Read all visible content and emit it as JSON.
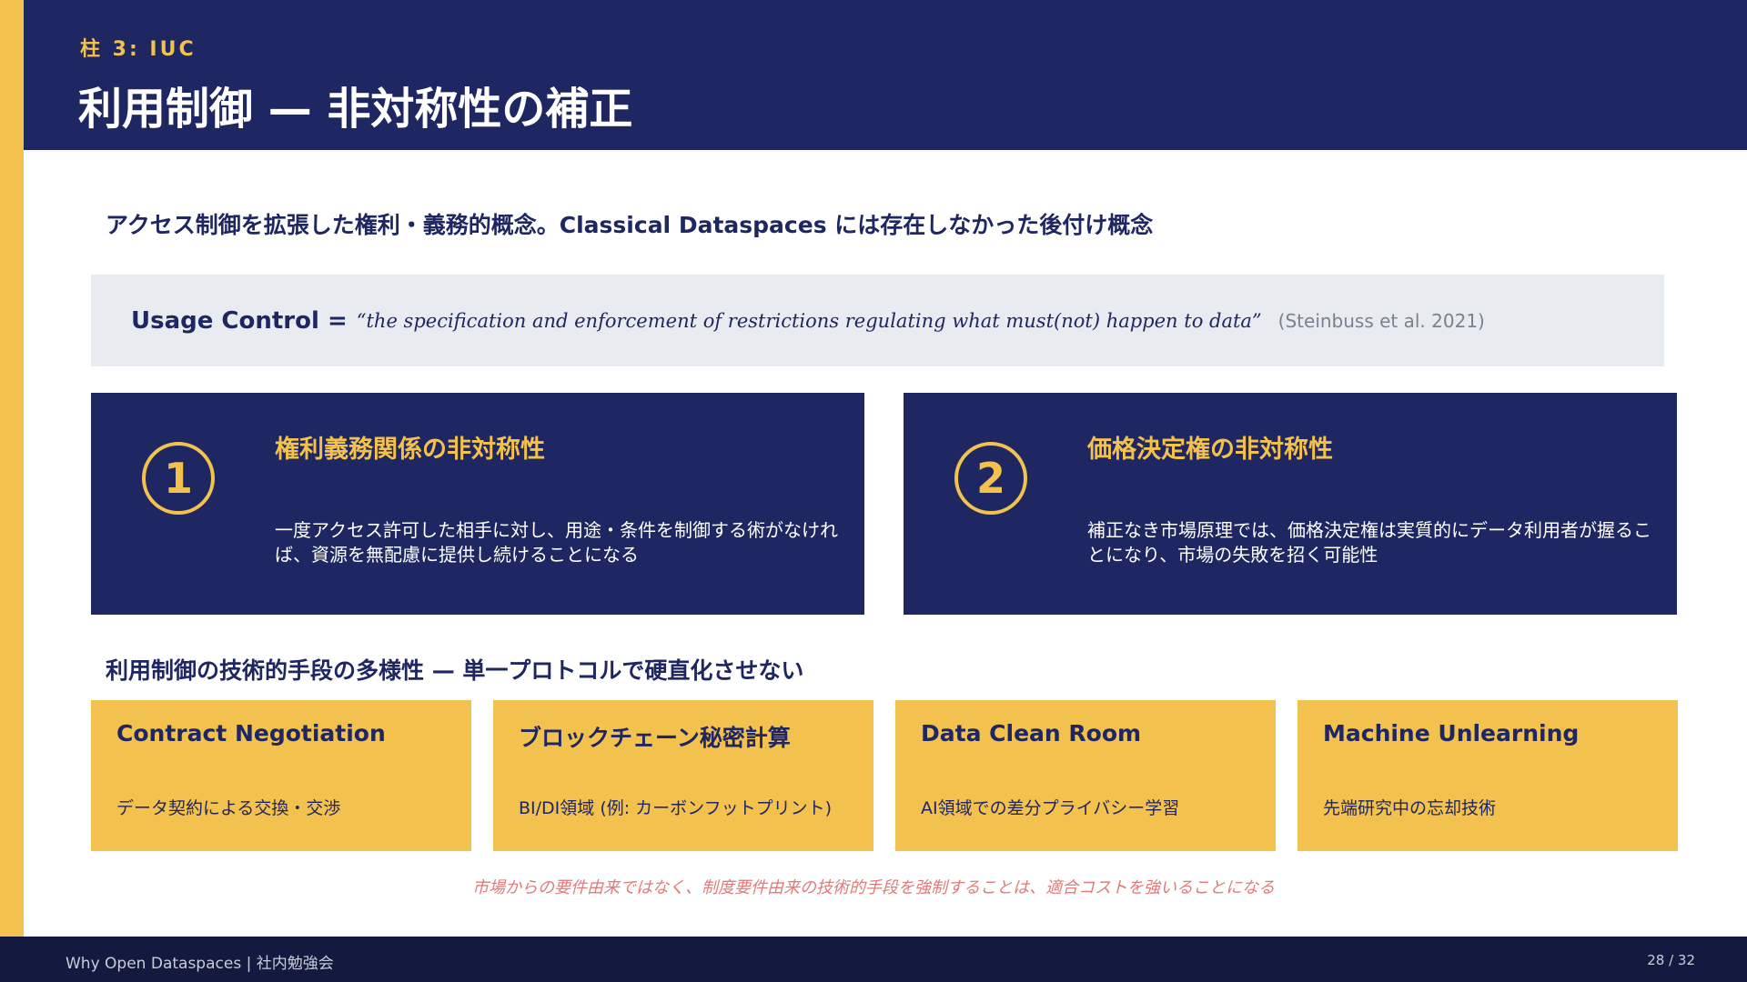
{
  "header": {
    "pillar": "柱 3: IUC",
    "title": "利用制御 — 非対称性の補正"
  },
  "intro": "アクセス制御を拡張した権利・義務的概念。Classical Dataspaces には存在しなかった後付け概念",
  "definition": {
    "term": "Usage Control =",
    "quote": "“the specification and enforcement of restrictions regulating what must(not) happen to data”",
    "citation": "(Steinbuss et al. 2021)"
  },
  "asymmetries": [
    {
      "number": "1",
      "title": "権利義務関係の非対称性",
      "body": "一度アクセス許可した相手に対し、用途・条件を制御する術がなければ、資源を無配慮に提供し続けることになる"
    },
    {
      "number": "2",
      "title": "価格決定権の非対称性",
      "body": "補正なき市場原理では、価格決定権は実質的にデータ利用者が握ることになり、市場の失敗を招く可能性"
    }
  ],
  "techniques_heading": "利用制御の技術的手段の多様性 — 単一プロトコルで硬直化させない",
  "techniques": [
    {
      "title": "Contract Negotiation",
      "desc": "データ契約による交換・交渉"
    },
    {
      "title": "ブロックチェーン秘密計算",
      "desc": "BI/DI領域 (例: カーボンフットプリント)"
    },
    {
      "title": "Data Clean Room",
      "desc": "AI領域での差分プライバシー学習"
    },
    {
      "title": "Machine Unlearning",
      "desc": "先端研究中の忘却技術"
    }
  ],
  "note": "市場からの要件由来ではなく、制度要件由来の技術的手段を強制することは、適合コストを強いることになる",
  "footer": {
    "left": "Why Open Dataspaces | 社内勉強会",
    "page": "28 / 32"
  },
  "colors": {
    "navy": "#1e2761",
    "accent": "#f2c14e",
    "note": "#e07b7b"
  }
}
